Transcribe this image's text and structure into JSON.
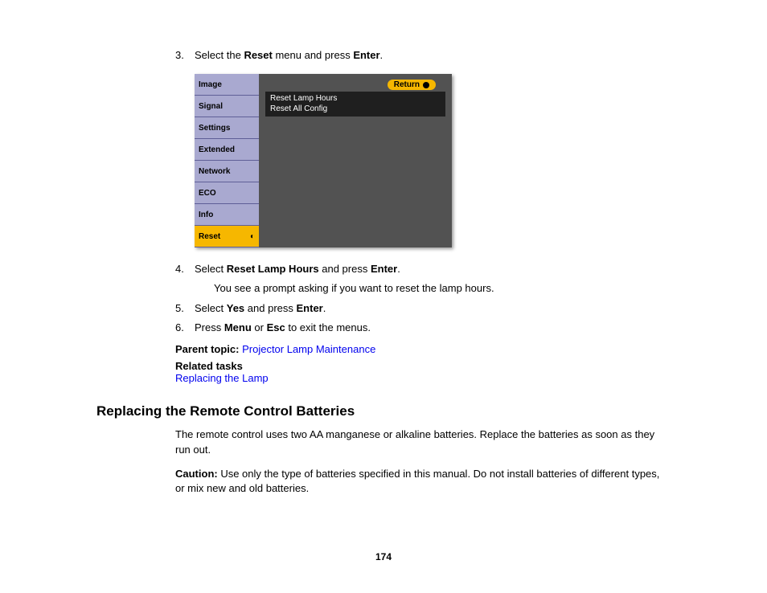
{
  "steps": {
    "s3_pre": "Select the ",
    "s3_b1": "Reset",
    "s3_mid": " menu and press ",
    "s3_b2": "Enter",
    "s3_end": ".",
    "s4_pre": "Select ",
    "s4_b1": "Reset Lamp Hours",
    "s4_mid": " and press ",
    "s4_b2": "Enter",
    "s4_end": ".",
    "s4_sub": "You see a prompt asking if you want to reset the lamp hours.",
    "s5_pre": "Select ",
    "s5_b1": "Yes",
    "s5_mid": " and press ",
    "s5_b2": "Enter",
    "s5_end": ".",
    "s6_pre": "Press ",
    "s6_b1": "Menu",
    "s6_mid": " or ",
    "s6_b2": "Esc",
    "s6_end": " to exit the menus."
  },
  "menu": {
    "items": [
      "Image",
      "Signal",
      "Settings",
      "Extended",
      "Network",
      "ECO",
      "Info"
    ],
    "active": "Reset",
    "return": "Return",
    "sub1": "Reset Lamp Hours",
    "sub2": "Reset All Config"
  },
  "parent_topic_label": "Parent topic:",
  "parent_topic_link": "Projector Lamp Maintenance",
  "related_tasks_label": "Related tasks",
  "related_task_link": "Replacing the Lamp",
  "section_heading": "Replacing the Remote Control Batteries",
  "section_p1": "The remote control uses two AA manganese or alkaline batteries. Replace the batteries as soon as they run out.",
  "caution_label": "Caution:",
  "caution_text": " Use only the type of batteries specified in this manual. Do not install batteries of different types, or mix new and old batteries.",
  "page_number": "174"
}
